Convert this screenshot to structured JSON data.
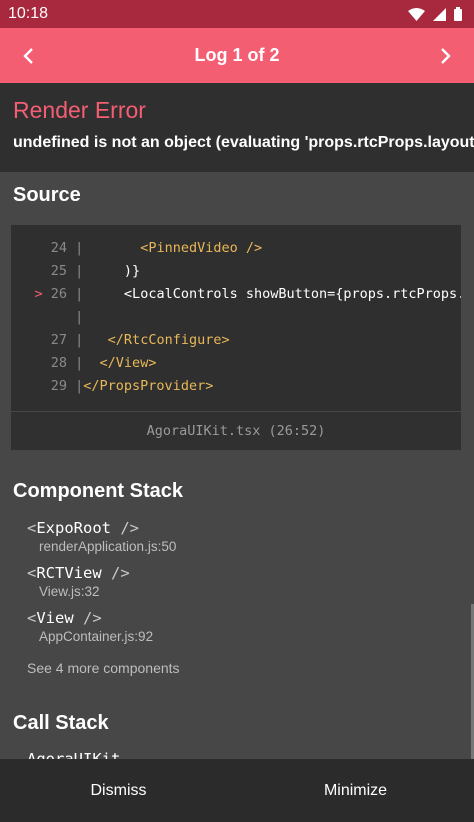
{
  "status": {
    "time": "10:18"
  },
  "header": {
    "title": "Log 1 of 2"
  },
  "error": {
    "title": "Render Error",
    "message": "undefined is not an object (evaluating 'props.rtcProps.layout')"
  },
  "source": {
    "title": "Source",
    "lines": [
      {
        "num": "24",
        "code": "      <PinnedVideo />"
      },
      {
        "num": "25",
        "code": "    )}"
      },
      {
        "num": "26",
        "code": "    <LocalControls showButton={props.rtcProps.showButton}"
      },
      {
        "num": "",
        "code": ""
      },
      {
        "num": "27",
        "code": "  </RtcConfigure>"
      },
      {
        "num": "28",
        "code": " </View>"
      },
      {
        "num": "29",
        "code": "</PropsProvider>"
      }
    ],
    "highlight_marker": ">",
    "file": "AgoraUIKit.tsx (26:52)"
  },
  "component_stack": {
    "title": "Component Stack",
    "items": [
      {
        "name": "ExpoRoot",
        "file": "renderApplication.js:50"
      },
      {
        "name": "RCTView",
        "file": "View.js:32"
      },
      {
        "name": "View",
        "file": "AppContainer.js:92"
      }
    ],
    "see_more": "See 4 more components"
  },
  "call_stack": {
    "title": "Call Stack",
    "first_item": "AgoraUIKit"
  },
  "footer": {
    "dismiss": "Dismiss",
    "minimize": "Minimize"
  }
}
